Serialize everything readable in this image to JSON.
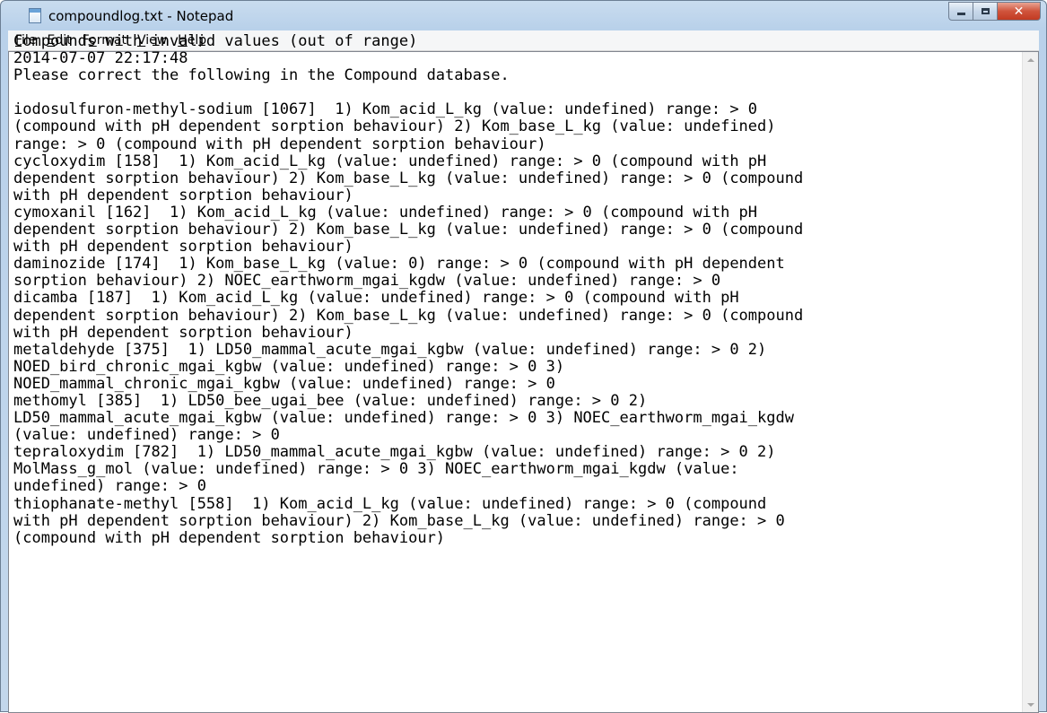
{
  "window": {
    "title": "compoundlog.txt - Notepad",
    "icon": "notepad-icon",
    "buttons": {
      "minimize_icon": "minimize-icon",
      "maximize_icon": "maximize-icon",
      "close_label": "✕"
    }
  },
  "menubar": {
    "items": [
      {
        "label": "File",
        "accelerator": "F"
      },
      {
        "label": "Edit",
        "accelerator": "E"
      },
      {
        "label": "Format",
        "accelerator": "o"
      },
      {
        "label": "View",
        "accelerator": "V"
      },
      {
        "label": "Help",
        "accelerator": "H"
      }
    ]
  },
  "document": {
    "lines": [
      "Compounds with invalid values (out of range)",
      "2014-07-07 22:17:48",
      "Please correct the following in the Compound database.",
      "",
      "iodosulfuron-methyl-sodium [1067]  1) Kom_acid_L_kg (value: undefined) range: > 0",
      "(compound with pH dependent sorption behaviour) 2) Kom_base_L_kg (value: undefined)",
      "range: > 0 (compound with pH dependent sorption behaviour)",
      "cycloxydim [158]  1) Kom_acid_L_kg (value: undefined) range: > 0 (compound with pH",
      "dependent sorption behaviour) 2) Kom_base_L_kg (value: undefined) range: > 0 (compound",
      "with pH dependent sorption behaviour)",
      "cymoxanil [162]  1) Kom_acid_L_kg (value: undefined) range: > 0 (compound with pH",
      "dependent sorption behaviour) 2) Kom_base_L_kg (value: undefined) range: > 0 (compound",
      "with pH dependent sorption behaviour)",
      "daminozide [174]  1) Kom_base_L_kg (value: 0) range: > 0 (compound with pH dependent",
      "sorption behaviour) 2) NOEC_earthworm_mgai_kgdw (value: undefined) range: > 0",
      "dicamba [187]  1) Kom_acid_L_kg (value: undefined) range: > 0 (compound with pH",
      "dependent sorption behaviour) 2) Kom_base_L_kg (value: undefined) range: > 0 (compound",
      "with pH dependent sorption behaviour)",
      "metaldehyde [375]  1) LD50_mammal_acute_mgai_kgbw (value: undefined) range: > 0 2)",
      "NOED_bird_chronic_mgai_kgbw (value: undefined) range: > 0 3)",
      "NOED_mammal_chronic_mgai_kgbw (value: undefined) range: > 0",
      "methomyl [385]  1) LD50_bee_ugai_bee (value: undefined) range: > 0 2)",
      "LD50_mammal_acute_mgai_kgbw (value: undefined) range: > 0 3) NOEC_earthworm_mgai_kgdw",
      "(value: undefined) range: > 0",
      "tepraloxydim [782]  1) LD50_mammal_acute_mgai_kgbw (value: undefined) range: > 0 2)",
      "MolMass_g_mol (value: undefined) range: > 0 3) NOEC_earthworm_mgai_kgdw (value:",
      "undefined) range: > 0",
      "thiophanate-methyl [558]  1) Kom_acid_L_kg (value: undefined) range: > 0 (compound",
      "with pH dependent sorption behaviour) 2) Kom_base_L_kg (value: undefined) range: > 0",
      "(compound with pH dependent sorption behaviour)"
    ]
  },
  "scrollbar": {
    "up_icon": "scroll-up-icon",
    "down_icon": "scroll-down-icon"
  },
  "colors": {
    "titlebar": "#b9d1ea",
    "close_button": "#c23a22",
    "menubar": "#f5f6f7",
    "editor_background": "#ffffff"
  }
}
